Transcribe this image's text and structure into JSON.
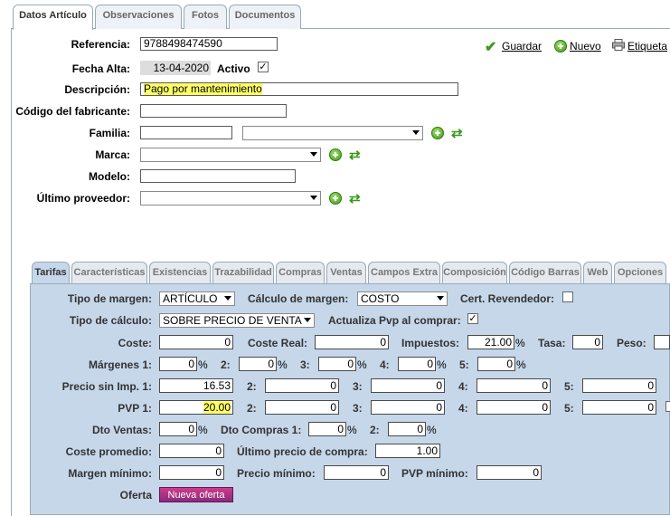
{
  "tabs": [
    "Datos Artículo",
    "Observaciones",
    "Fotos",
    "Documentos"
  ],
  "actions": {
    "save": "Guardar",
    "new": "Nuevo",
    "labels": "Etiqueta"
  },
  "form": {
    "referencia_label": "Referencia:",
    "referencia": "9788498474590",
    "fecha_alta_label": "Fecha Alta:",
    "fecha_alta": "13-04-2020",
    "activo_label": "Activo",
    "activo_check": "✓",
    "descripcion_label": "Descripción:",
    "descripcion": "Pago por mantenimiento",
    "codigo_label": "Código del fabricante:",
    "codigo": "",
    "familia_label": "Familia:",
    "familia": "",
    "familia_select": "",
    "marca_label": "Marca:",
    "marca": "",
    "modelo_label": "Modelo:",
    "modelo": "",
    "proveedor_label": "Último proveedor:",
    "proveedor": ""
  },
  "subtabs": [
    "Tarifas",
    "Características",
    "Existencias",
    "Trazabilidad",
    "Compras",
    "Ventas",
    "Campos Extra",
    "Composición",
    "Código Barras",
    "Web",
    "Opciones"
  ],
  "tarifas": {
    "tipo_margen_label": "Tipo de margen:",
    "tipo_margen": "ARTÍCULO",
    "calculo_margen_label": "Cálculo de margen:",
    "calculo_margen": "COSTO",
    "cert_revendedor_label": "Cert. Revendedor:",
    "tipo_calculo_label": "Tipo de cálculo:",
    "tipo_calculo": "SOBRE PRECIO DE VENTA",
    "actualiza_label": "Actualiza Pvp al comprar:",
    "actualiza_check": "✓",
    "coste_label": "Coste:",
    "coste": "0",
    "coste_real_label": "Coste Real:",
    "coste_real": "0",
    "impuestos_label": "Impuestos:",
    "impuestos": "21.00",
    "tasa_label": "Tasa:",
    "tasa": "0",
    "peso_label": "Peso:",
    "peso": "",
    "margenes_label": "Márgenes 1:",
    "margenes": [
      "0",
      "0",
      "0",
      "0",
      "0"
    ],
    "precio_sin_label": "Precio sin Imp. 1:",
    "precio_sin": [
      "16.53",
      "0",
      "0",
      "0",
      "0"
    ],
    "pvp_label": "PVP 1:",
    "pvp": [
      "20.00",
      "0",
      "0",
      "0",
      "0"
    ],
    "idx2": "2:",
    "idx3": "3:",
    "idx4": "4:",
    "idx5": "5:",
    "pct": "%",
    "dto_ventas_label": "Dto Ventas:",
    "dto_ventas": "0",
    "dto_compras_label": "Dto Compras 1:",
    "dto_compras": "0",
    "dto_compras2": "0",
    "coste_promedio_label": "Coste promedio:",
    "coste_promedio": "0",
    "ultimo_precio_label": "Último precio de compra:",
    "ultimo_precio": "1.00",
    "margen_minimo_label": "Margen mínimo:",
    "margen_minimo": "0",
    "precio_minimo_label": "Precio mínimo:",
    "precio_minimo": "0",
    "pvp_minimo_label": "PVP mínimo:",
    "pvp_minimo": "0",
    "oferta_label": "Oferta",
    "oferta_button": "Nueva oferta"
  }
}
